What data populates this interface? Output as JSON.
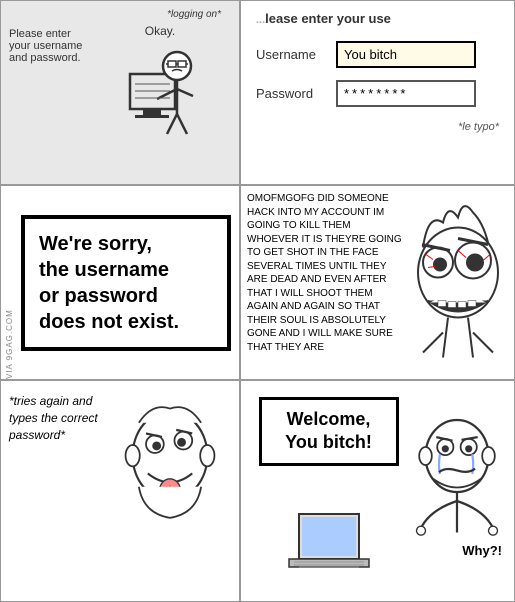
{
  "cell1": {
    "logging_on": "*logging on*",
    "prompt": "Please enter your username and password.",
    "okay": "Okay."
  },
  "cell2": {
    "title": "lease enter your use",
    "username_label": "Username",
    "username_value": "You bitch",
    "password_label": "Password",
    "password_value": "********",
    "typo": "*le typo*"
  },
  "cell3": {
    "error_line1": "We're sorry,",
    "error_line2": "the username",
    "error_line3": "or password",
    "error_line4": "does not exist."
  },
  "cell4": {
    "rage": "OMOFMGOFG DID SOMEONE HACK INTO MY ACCOUNT IM GOING TO KILL THEM WHOEVER IT IS THEYRE GOING TO GET SHOT IN THE FACE SEVERAL TIMES UNTIL THEY ARE DEAD AND EVEN AFTER THAT I WILL SHOOT THEM AGAIN AND AGAIN SO THAT THEIR SOUL IS ABSOLUTELY GONE AND I WILL MAKE SURE THAT THEY ARE"
  },
  "cell5": {
    "tries_text": "*tries again and types the correct password*"
  },
  "cell6": {
    "welcome_line1": "Welcome,",
    "welcome_line2": "You bitch!",
    "why": "Why?!"
  }
}
